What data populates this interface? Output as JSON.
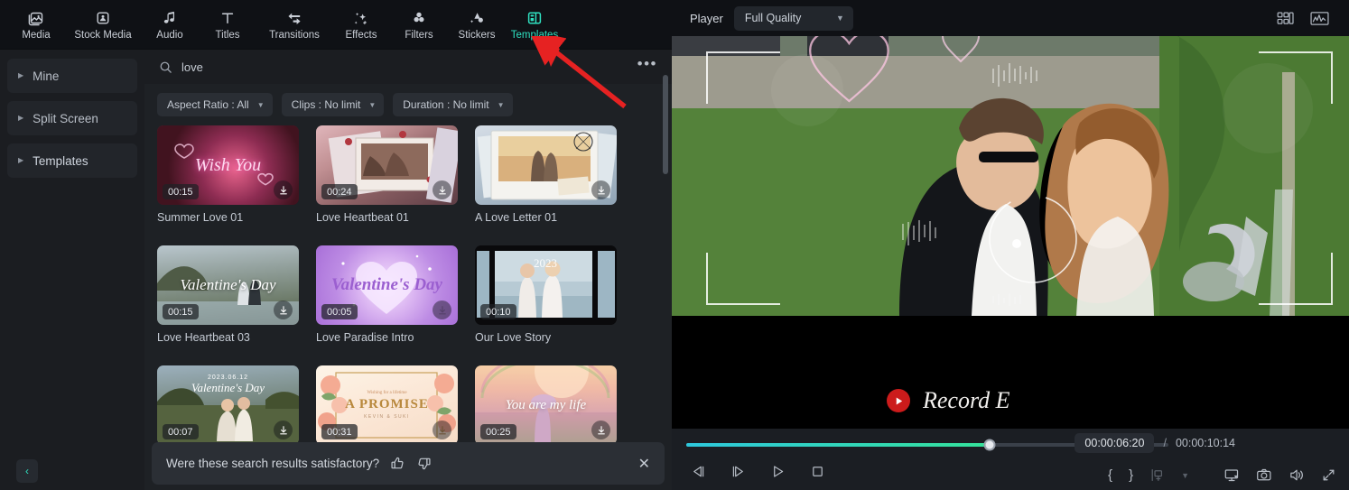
{
  "app": {
    "accent": "#2fe0c0",
    "panel_bg": "#1e2125",
    "annotation_color": "#e62222"
  },
  "tabstrip": {
    "tabs": [
      {
        "label": "Media",
        "icon": "media-icon",
        "active": false
      },
      {
        "label": "Stock Media",
        "icon": "stock-media-icon",
        "active": false
      },
      {
        "label": "Audio",
        "icon": "audio-icon",
        "active": false
      },
      {
        "label": "Titles",
        "icon": "titles-icon",
        "active": false
      },
      {
        "label": "Transitions",
        "icon": "transitions-icon",
        "active": false
      },
      {
        "label": "Effects",
        "icon": "effects-icon",
        "active": false
      },
      {
        "label": "Filters",
        "icon": "filters-icon",
        "active": false
      },
      {
        "label": "Stickers",
        "icon": "stickers-icon",
        "active": false
      },
      {
        "label": "Templates",
        "icon": "templates-icon",
        "active": true
      }
    ]
  },
  "sidebar": {
    "items": [
      {
        "label": "Mine"
      },
      {
        "label": "Split Screen"
      },
      {
        "label": "Templates"
      }
    ],
    "collapse_glyph": "‹"
  },
  "search": {
    "value": "love",
    "placeholder": "Search",
    "icon": "search-icon",
    "more_glyph": "•••"
  },
  "filters": [
    {
      "label": "Aspect Ratio : All"
    },
    {
      "label": "Clips : No limit"
    },
    {
      "label": "Duration : No limit"
    }
  ],
  "templates": [
    {
      "name": "Summer Love 01",
      "duration": "00:15",
      "art": "t1",
      "overlay": "Wish You"
    },
    {
      "name": "Love Heartbeat 01",
      "duration": "00:24",
      "art": "t2",
      "overlay": ""
    },
    {
      "name": "A Love Letter 01",
      "duration": "",
      "art": "t3",
      "overlay": ""
    },
    {
      "name": "Love Heartbeat 03",
      "duration": "00:15",
      "art": "t4",
      "overlay": "Valentine's Day"
    },
    {
      "name": "Love Paradise Intro",
      "duration": "00:05",
      "art": "t5",
      "overlay": "Valentine's Day"
    },
    {
      "name": "Our Love Story",
      "duration": "00:10",
      "art": "t6",
      "overlay": "2023"
    },
    {
      "name": "",
      "duration": "00:07",
      "art": "t7",
      "overlay": "Valentine's Day"
    },
    {
      "name": "",
      "duration": "00:31",
      "art": "t8",
      "overlay": "A PROMISE"
    },
    {
      "name": "",
      "duration": "00:25",
      "art": "t9",
      "overlay": "You are my life"
    }
  ],
  "feedback": {
    "question": "Were these search results satisfactory?",
    "thumbs_up": "thumbs-up-icon",
    "thumbs_down": "thumbs-down-icon",
    "close_glyph": "✕"
  },
  "player": {
    "label": "Player",
    "quality": "Full Quality",
    "quality_caret": "∨",
    "header_icons": [
      "grid-layout-icon",
      "waveform-icon"
    ],
    "caption_text": "Record E",
    "current_time": "00:00:06:20",
    "separator": "/",
    "total_time": "00:00:10:14",
    "progress_percent": 63,
    "transport": [
      {
        "name": "prev-frame-button",
        "glyph": "prev-frame-icon"
      },
      {
        "name": "next-frame-button",
        "glyph": "next-frame-icon"
      },
      {
        "name": "play-button",
        "glyph": "play-icon"
      },
      {
        "name": "stop-button",
        "glyph": "stop-icon"
      }
    ],
    "right_controls": [
      {
        "name": "mark-in-button",
        "label": "{"
      },
      {
        "name": "mark-out-button",
        "label": "}"
      },
      {
        "name": "add-marker-button",
        "label": "add-marker-icon"
      },
      {
        "name": "marker-dropdown-button",
        "label": "chevron-down-icon"
      },
      {
        "name": "display-settings-button",
        "label": "display-icon"
      },
      {
        "name": "snapshot-button",
        "label": "camera-icon"
      },
      {
        "name": "volume-button",
        "label": "speaker-icon"
      },
      {
        "name": "fullscreen-button",
        "label": "expand-icon"
      }
    ]
  }
}
